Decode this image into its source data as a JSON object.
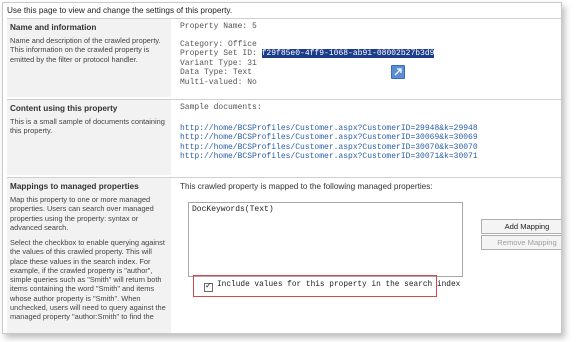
{
  "intro": "Use this page to view and change the settings of this property.",
  "sections": {
    "name_info": {
      "title": "Name and information",
      "desc": "Name and description of the crawled property. This information on the crawled property is emitted by the filter or protocol handler."
    },
    "content": {
      "title": "Content using this property",
      "desc": "This is a small sample of documents containing this property."
    },
    "mappings": {
      "title": "Mappings to managed properties",
      "desc": "Map this property to one or more managed properties. Users can search over managed properties using the property: syntax or advanced search.",
      "desc2": "Select the checkbox to enable querying against the values of this crawled property. This will place these values in the search index. For example, if the crawled property is \"author\", simple queries such as \"Smith\" will return both items containing the word \"Smith\" and items whose author property is \"Smith\". When unchecked, users will need to query against the managed property \"author:Smith\" to find the"
    }
  },
  "property": {
    "name_label": "Property Name:",
    "name_value": "5",
    "category_label": "Category:",
    "category_value": "Office",
    "setid_label": "Property Set ID:",
    "setid_value": "f29f85e0-4ff9-1068-ab91-08002b27b3d9",
    "variant_label": "Variant Type:",
    "variant_value": "31",
    "datatype_label": "Data Type:",
    "datatype_value": "Text",
    "multivalued_label": "Multi-valued:",
    "multivalued_value": "No"
  },
  "sample": {
    "label": "Sample documents:",
    "links": [
      "http://home/BCSProfiles/Customer.aspx?CustomerID=29948&k=29948",
      "http://home/BCSProfiles/Customer.aspx?CustomerID=30069&k=30069",
      "http://home/BCSProfiles/Customer.aspx?CustomerID=30070&k=30070",
      "http://home/BCSProfiles/Customer.aspx?CustomerID=30071&k=30071"
    ]
  },
  "mapping": {
    "label": "This crawled property is mapped to the following managed properties:",
    "mapped": [
      "DocKeywords(Text)"
    ],
    "add_button": "Add Mapping",
    "remove_button": "Remove Mapping",
    "checkbox_label": "Include values for this property in the search index",
    "checkbox_checked": true
  }
}
